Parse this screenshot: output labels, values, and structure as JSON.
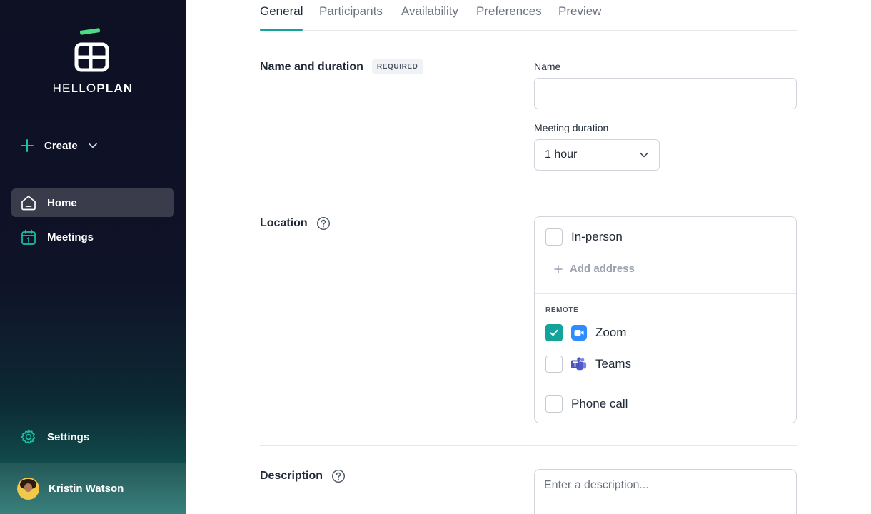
{
  "app": {
    "logo_light": "HELLO",
    "logo_bold": "PLAN",
    "accent": "#14a39a",
    "logo_accent": "#4ade80"
  },
  "sidebar": {
    "create_label": "Create",
    "items": [
      {
        "label": "Home",
        "icon": "home-icon",
        "active": true
      },
      {
        "label": "Meetings",
        "icon": "calendar-icon",
        "active": false
      }
    ],
    "settings_label": "Settings",
    "user_name": "Kristin Watson"
  },
  "tabs": [
    {
      "label": "General",
      "active": true
    },
    {
      "label": "Participants",
      "active": false
    },
    {
      "label": "Availability",
      "active": false
    },
    {
      "label": "Preferences",
      "active": false
    },
    {
      "label": "Preview",
      "active": false
    }
  ],
  "name_section": {
    "title": "Name and duration",
    "badge": "REQUIRED",
    "name_label": "Name",
    "name_value": "",
    "duration_label": "Meeting duration",
    "duration_value": "1 hour"
  },
  "location_section": {
    "title": "Location",
    "in_person_label": "In-person",
    "in_person_checked": false,
    "add_address_label": "Add address",
    "remote_label": "REMOTE",
    "zoom_label": "Zoom",
    "zoom_checked": true,
    "teams_label": "Teams",
    "teams_checked": false,
    "phone_label": "Phone call",
    "phone_checked": false
  },
  "description_section": {
    "title": "Description",
    "placeholder": "Enter a description..."
  }
}
